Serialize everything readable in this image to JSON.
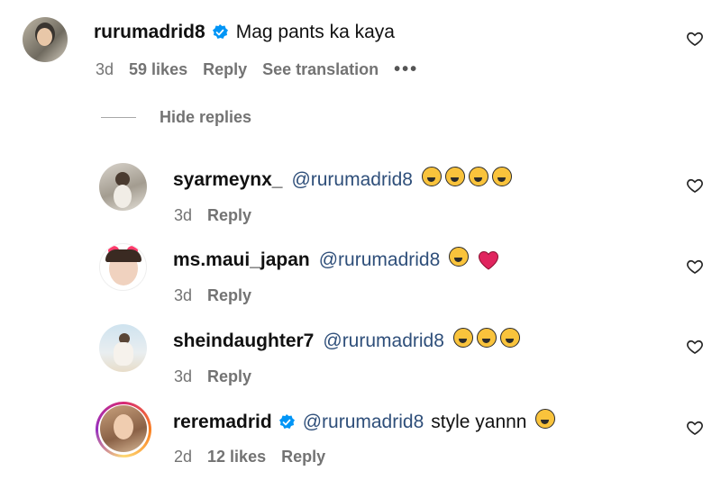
{
  "main_comment": {
    "username": "rurumadrid8",
    "text": "Mag pants ka kaya",
    "age": "3d",
    "likes": "59 likes",
    "reply_label": "Reply",
    "translate_label": "See translation",
    "more_label": "•••"
  },
  "hide_replies_label": "Hide replies",
  "replies": [
    {
      "username": "syarmeynx_",
      "mention": "@rurumadrid8",
      "text": "",
      "age": "3d",
      "likes": "",
      "reply_label": "Reply"
    },
    {
      "username": "ms.maui_japan",
      "mention": "@rurumadrid8",
      "text": "",
      "age": "3d",
      "likes": "",
      "reply_label": "Reply"
    },
    {
      "username": "sheindaughter7",
      "mention": "@rurumadrid8",
      "text": "",
      "age": "3d",
      "likes": "",
      "reply_label": "Reply"
    },
    {
      "username": "reremadrid",
      "mention": "@rurumadrid8",
      "text": "style yannn",
      "age": "2d",
      "likes": "12 likes",
      "reply_label": "Reply"
    }
  ],
  "colors": {
    "verified": "#0095f6",
    "mention": "#2f4f7a",
    "meta": "#737373",
    "heart": "#e0245e"
  },
  "icons": [
    "heart-outline-icon",
    "verified-badge-icon",
    "laughing-emoji-icon",
    "red-heart-emoji-icon"
  ]
}
